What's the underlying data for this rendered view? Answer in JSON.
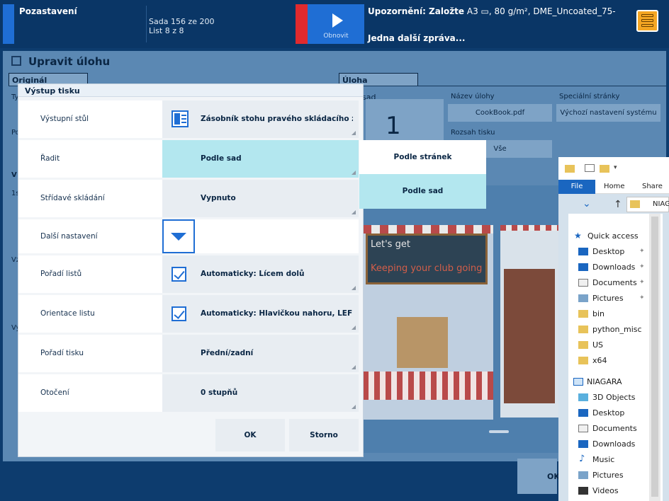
{
  "topbar": {
    "title": "Pozastavení",
    "set": "Sada 156 ze 200",
    "sheet": "List 8 z 8",
    "refresh_label": "Obnovit",
    "warning_prefix": "Upozornění: Založte",
    "warning_detail": " A3 ▭, 80 g/m², DME_Uncoated_75-",
    "next_message": "Jedna další zpráva..."
  },
  "background": {
    "title": "Upravit úlohu",
    "tab_original": "Originál",
    "tab_job": "Úloha",
    "sets_label_fragment": "sad",
    "sets_value": "1",
    "job_name_label": "Název úlohy",
    "job_name_value": "CookBook.pdf",
    "print_range_label": "Rozsah tisku",
    "print_range_value": "Vše",
    "special_pages_label": "Speciální stránky",
    "special_pages_value": "Výchozí nastavení systému",
    "side_fragments": [
      "Ty",
      "Po",
      "V",
      "1s",
      "Vz",
      "Vy"
    ],
    "ok_fragment": "OK",
    "preview_line1": "Let's get",
    "preview_line2": "Keeping your club going"
  },
  "dialog": {
    "title": "Výstup tisku",
    "rows": [
      {
        "label": "Výstupní stůl",
        "value": "Zásobník stohu pravého skládacího za..."
      },
      {
        "label": "Řadit",
        "value": "Podle sad"
      },
      {
        "label": "Střídavé skládání",
        "value": "Vypnuto"
      },
      {
        "label": "Další nastavení",
        "value": ""
      },
      {
        "label": "Pořadí listů",
        "value": "Automaticky: Lícem dolů"
      },
      {
        "label": "Orientace listu",
        "value": "Automaticky: Hlavičkou nahoru, LEF"
      },
      {
        "label": "Pořadí tisku",
        "value": "Přední/zadní"
      },
      {
        "label": "Otočení",
        "value": "0 stupňů"
      }
    ],
    "ok_label": "OK",
    "cancel_label": "Storno"
  },
  "dropdown": {
    "options": [
      "Podle stránek",
      "Podle sad"
    ],
    "selected": "Podle sad"
  },
  "explorer": {
    "tabs": {
      "file": "File",
      "home": "Home",
      "share": "Share"
    },
    "address": "NIAG",
    "quick_access": "Quick access",
    "quick_items": [
      "Desktop",
      "Downloads",
      "Documents",
      "Pictures",
      "bin",
      "python_misc",
      "US",
      "x64"
    ],
    "computer": "NIAGARA",
    "computer_items": [
      "3D Objects",
      "Desktop",
      "Documents",
      "Downloads",
      "Music",
      "Pictures",
      "Videos"
    ]
  },
  "colors": {
    "accent": "#1f6ed4",
    "alert": "#e02a2e",
    "selected": "#b3e7ef",
    "menu": "#f5a623"
  }
}
